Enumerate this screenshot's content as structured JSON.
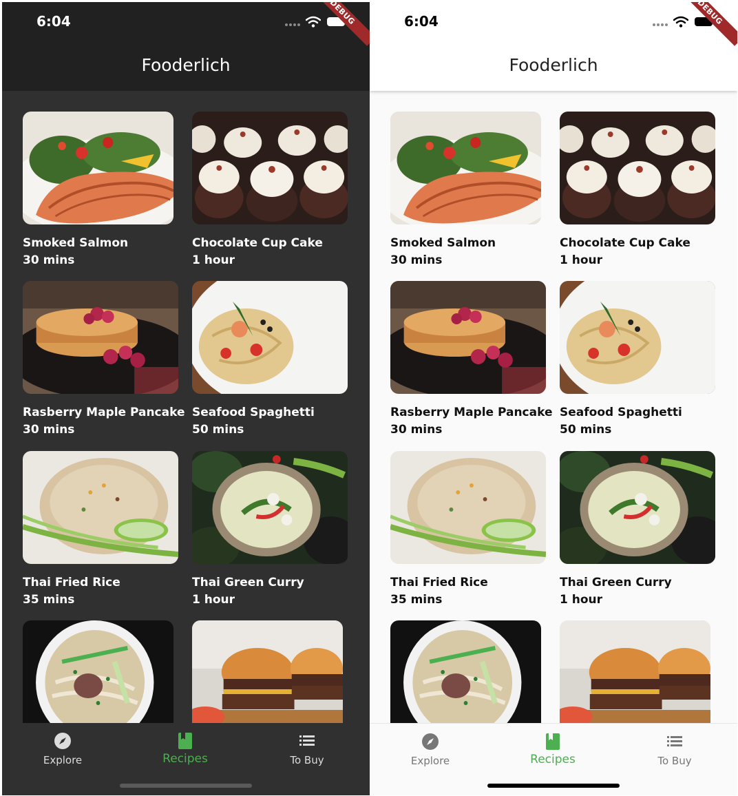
{
  "status_bar": {
    "time": "6:04",
    "debug_banner": "DEBUG"
  },
  "app_bar": {
    "title": "Fooderlich"
  },
  "recipes": [
    {
      "name": "Smoked Salmon",
      "duration": "30 mins",
      "image": "smoked-salmon-photo"
    },
    {
      "name": "Chocolate Cup Cake",
      "duration": "1 hour",
      "image": "chocolate-cupcake-photo"
    },
    {
      "name": "Rasberry Maple Pancake",
      "duration": "30 mins",
      "image": "raspberry-pancake-photo"
    },
    {
      "name": "Seafood Spaghetti",
      "duration": "50 mins",
      "image": "seafood-spaghetti-photo"
    },
    {
      "name": "Thai Fried Rice",
      "duration": "35 mins",
      "image": "thai-fried-rice-photo"
    },
    {
      "name": "Thai Green Curry",
      "duration": "1 hour",
      "image": "thai-green-curry-photo"
    },
    {
      "image": "pho-noodle-soup-photo"
    },
    {
      "image": "burger-photo"
    }
  ],
  "bottom_nav": [
    {
      "label": "Explore",
      "icon": "compass-icon"
    },
    {
      "label": "Recipes",
      "icon": "book-icon",
      "active": true
    },
    {
      "label": "To Buy",
      "icon": "list-icon"
    }
  ],
  "colors": {
    "accent": "#4caf50",
    "dark_bg": "#303030",
    "dark_appbar": "#212121",
    "light_bg": "#fafafa",
    "debug_banner": "#a02a2a"
  },
  "themes": [
    "dark",
    "light"
  ]
}
